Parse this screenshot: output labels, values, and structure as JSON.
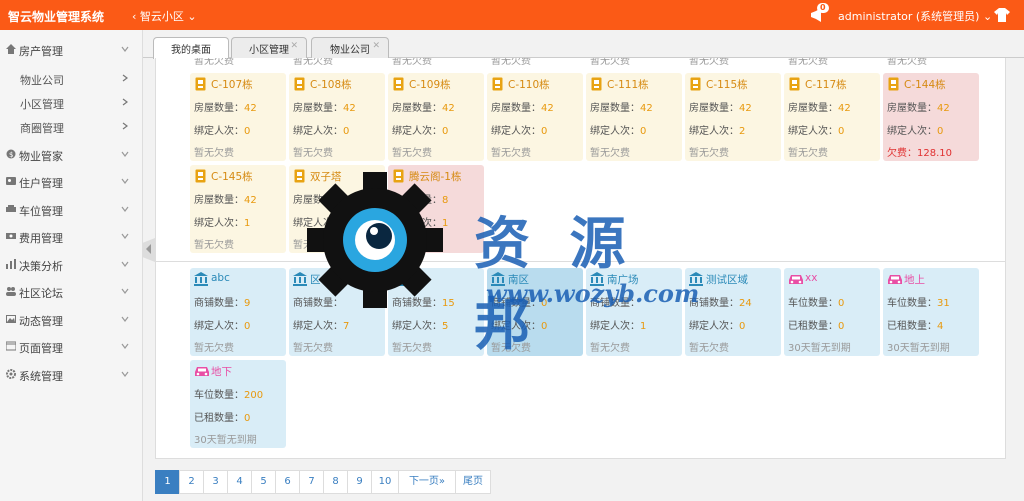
{
  "header": {
    "app_title": "智云物业管理系统",
    "community": "智云小区",
    "notifications": "0",
    "user": "administrator (系统管理员)"
  },
  "sidebar": {
    "items": [
      {
        "label": "房产管理",
        "icon": "home-icon"
      },
      {
        "label": "物业公司",
        "icon": ""
      },
      {
        "label": "小区管理",
        "icon": ""
      },
      {
        "label": "商圈管理",
        "icon": ""
      },
      {
        "label": "物业管家",
        "icon": "coin-icon"
      },
      {
        "label": "住户管理",
        "icon": "user-card-icon"
      },
      {
        "label": "车位管理",
        "icon": "car-icon"
      },
      {
        "label": "费用管理",
        "icon": "money-icon"
      },
      {
        "label": "决策分析",
        "icon": "chart-icon"
      },
      {
        "label": "社区论坛",
        "icon": "users-icon"
      },
      {
        "label": "动态管理",
        "icon": "picture-icon"
      },
      {
        "label": "页面管理",
        "icon": "page-icon"
      },
      {
        "label": "系统管理",
        "icon": "gear-icon"
      }
    ]
  },
  "tabs": [
    {
      "label": "我的桌面"
    },
    {
      "label": "小区管理"
    },
    {
      "label": "物业公司"
    }
  ],
  "partial_row": [
    "暂无欠费",
    "暂无欠费",
    "暂无欠费",
    "暂无欠费",
    "暂无欠费",
    "暂无欠费",
    "暂无欠费",
    "暂无欠费"
  ],
  "buildings": [
    {
      "name": "C-107栋",
      "l1": "房屋数量：",
      "v1": "42",
      "l2": "绑定人次：",
      "v2": "0",
      "s": "暂无欠费"
    },
    {
      "name": "C-108栋",
      "l1": "房屋数量：",
      "v1": "42",
      "l2": "绑定人次：",
      "v2": "0",
      "s": "暂无欠费"
    },
    {
      "name": "C-109栋",
      "l1": "房屋数量：",
      "v1": "42",
      "l2": "绑定人次：",
      "v2": "0",
      "s": "暂无欠费"
    },
    {
      "name": "C-110栋",
      "l1": "房屋数量：",
      "v1": "42",
      "l2": "绑定人次：",
      "v2": "0",
      "s": "暂无欠费"
    },
    {
      "name": "C-111栋",
      "l1": "房屋数量：",
      "v1": "42",
      "l2": "绑定人次：",
      "v2": "0",
      "s": "暂无欠费"
    },
    {
      "name": "C-115栋",
      "l1": "房屋数量：",
      "v1": "42",
      "l2": "绑定人次：",
      "v2": "2",
      "s": "暂无欠费"
    },
    {
      "name": "C-117栋",
      "l1": "房屋数量：",
      "v1": "42",
      "l2": "绑定人次：",
      "v2": "0",
      "s": "暂无欠费"
    },
    {
      "name": "C-144栋",
      "l1": "房屋数量：",
      "v1": "42",
      "l2": "绑定人次：",
      "v2": "0",
      "s": "欠费：128.10"
    },
    {
      "name": "C-145栋",
      "l1": "房屋数量：",
      "v1": "42",
      "l2": "绑定人次：",
      "v2": "1",
      "s": "暂无欠费"
    },
    {
      "name": "双子塔",
      "l1": "房屋数量：",
      "v1": "",
      "l2": "绑定人次：",
      "v2": "0",
      "s": "暂无欠费"
    },
    {
      "name": "腾云阁-1栋",
      "l1": "房屋数量：",
      "v1": "8",
      "l2": "绑定人次：",
      "v2": "1",
      "s": ""
    }
  ],
  "shops": [
    {
      "name": "abc",
      "l1": "商铺数量：",
      "v1": "9",
      "l2": "绑定人次：",
      "v2": "0",
      "s": "暂无欠费"
    },
    {
      "name": "区",
      "l1": "商铺数量：",
      "v1": "",
      "l2": "绑定人次：",
      "v2": "7",
      "s": "暂无欠费"
    },
    {
      "name": "场",
      "l1": "商铺数量：",
      "v1": "15",
      "l2": "绑定人次：",
      "v2": "5",
      "s": "暂无欠费"
    },
    {
      "name": "南区",
      "l1": "商铺数量：",
      "v1": "0",
      "l2": "绑定人次：",
      "v2": "0",
      "s": "暂无欠费"
    },
    {
      "name": "南广场",
      "l1": "商铺数量：",
      "v1": "",
      "l2": "绑定人次：",
      "v2": "1",
      "s": "暂无欠费"
    },
    {
      "name": "测试区域",
      "l1": "商铺数量：",
      "v1": "24",
      "l2": "绑定人次：",
      "v2": "0",
      "s": "暂无欠费"
    }
  ],
  "parkings": [
    {
      "name": "xx",
      "l1": "车位数量：",
      "v1": "0",
      "l2": "已租数量：",
      "v2": "0",
      "s": "30天暂无到期"
    },
    {
      "name": "地上",
      "l1": "车位数量：",
      "v1": "31",
      "l2": "已租数量：",
      "v2": "4",
      "s": "30天暂无到期"
    },
    {
      "name": "地下",
      "l1": "车位数量：",
      "v1": "200",
      "l2": "已租数量：",
      "v2": "0",
      "s": "30天暂无到期"
    }
  ],
  "pagination": {
    "pages": [
      "1",
      "2",
      "3",
      "4",
      "5",
      "6",
      "7",
      "8",
      "9",
      "10"
    ],
    "next": "下一页»",
    "last": "尾页",
    "current": "1"
  },
  "watermark": {
    "text": "资 源 邦",
    "url": "www.wozyb.com"
  },
  "colors": {
    "header": "#fb5a16",
    "building_card": "#fcf6e2",
    "owed_card": "#f5dada",
    "shop_card": "#d9edf7",
    "accent": "#3a7fc1"
  }
}
